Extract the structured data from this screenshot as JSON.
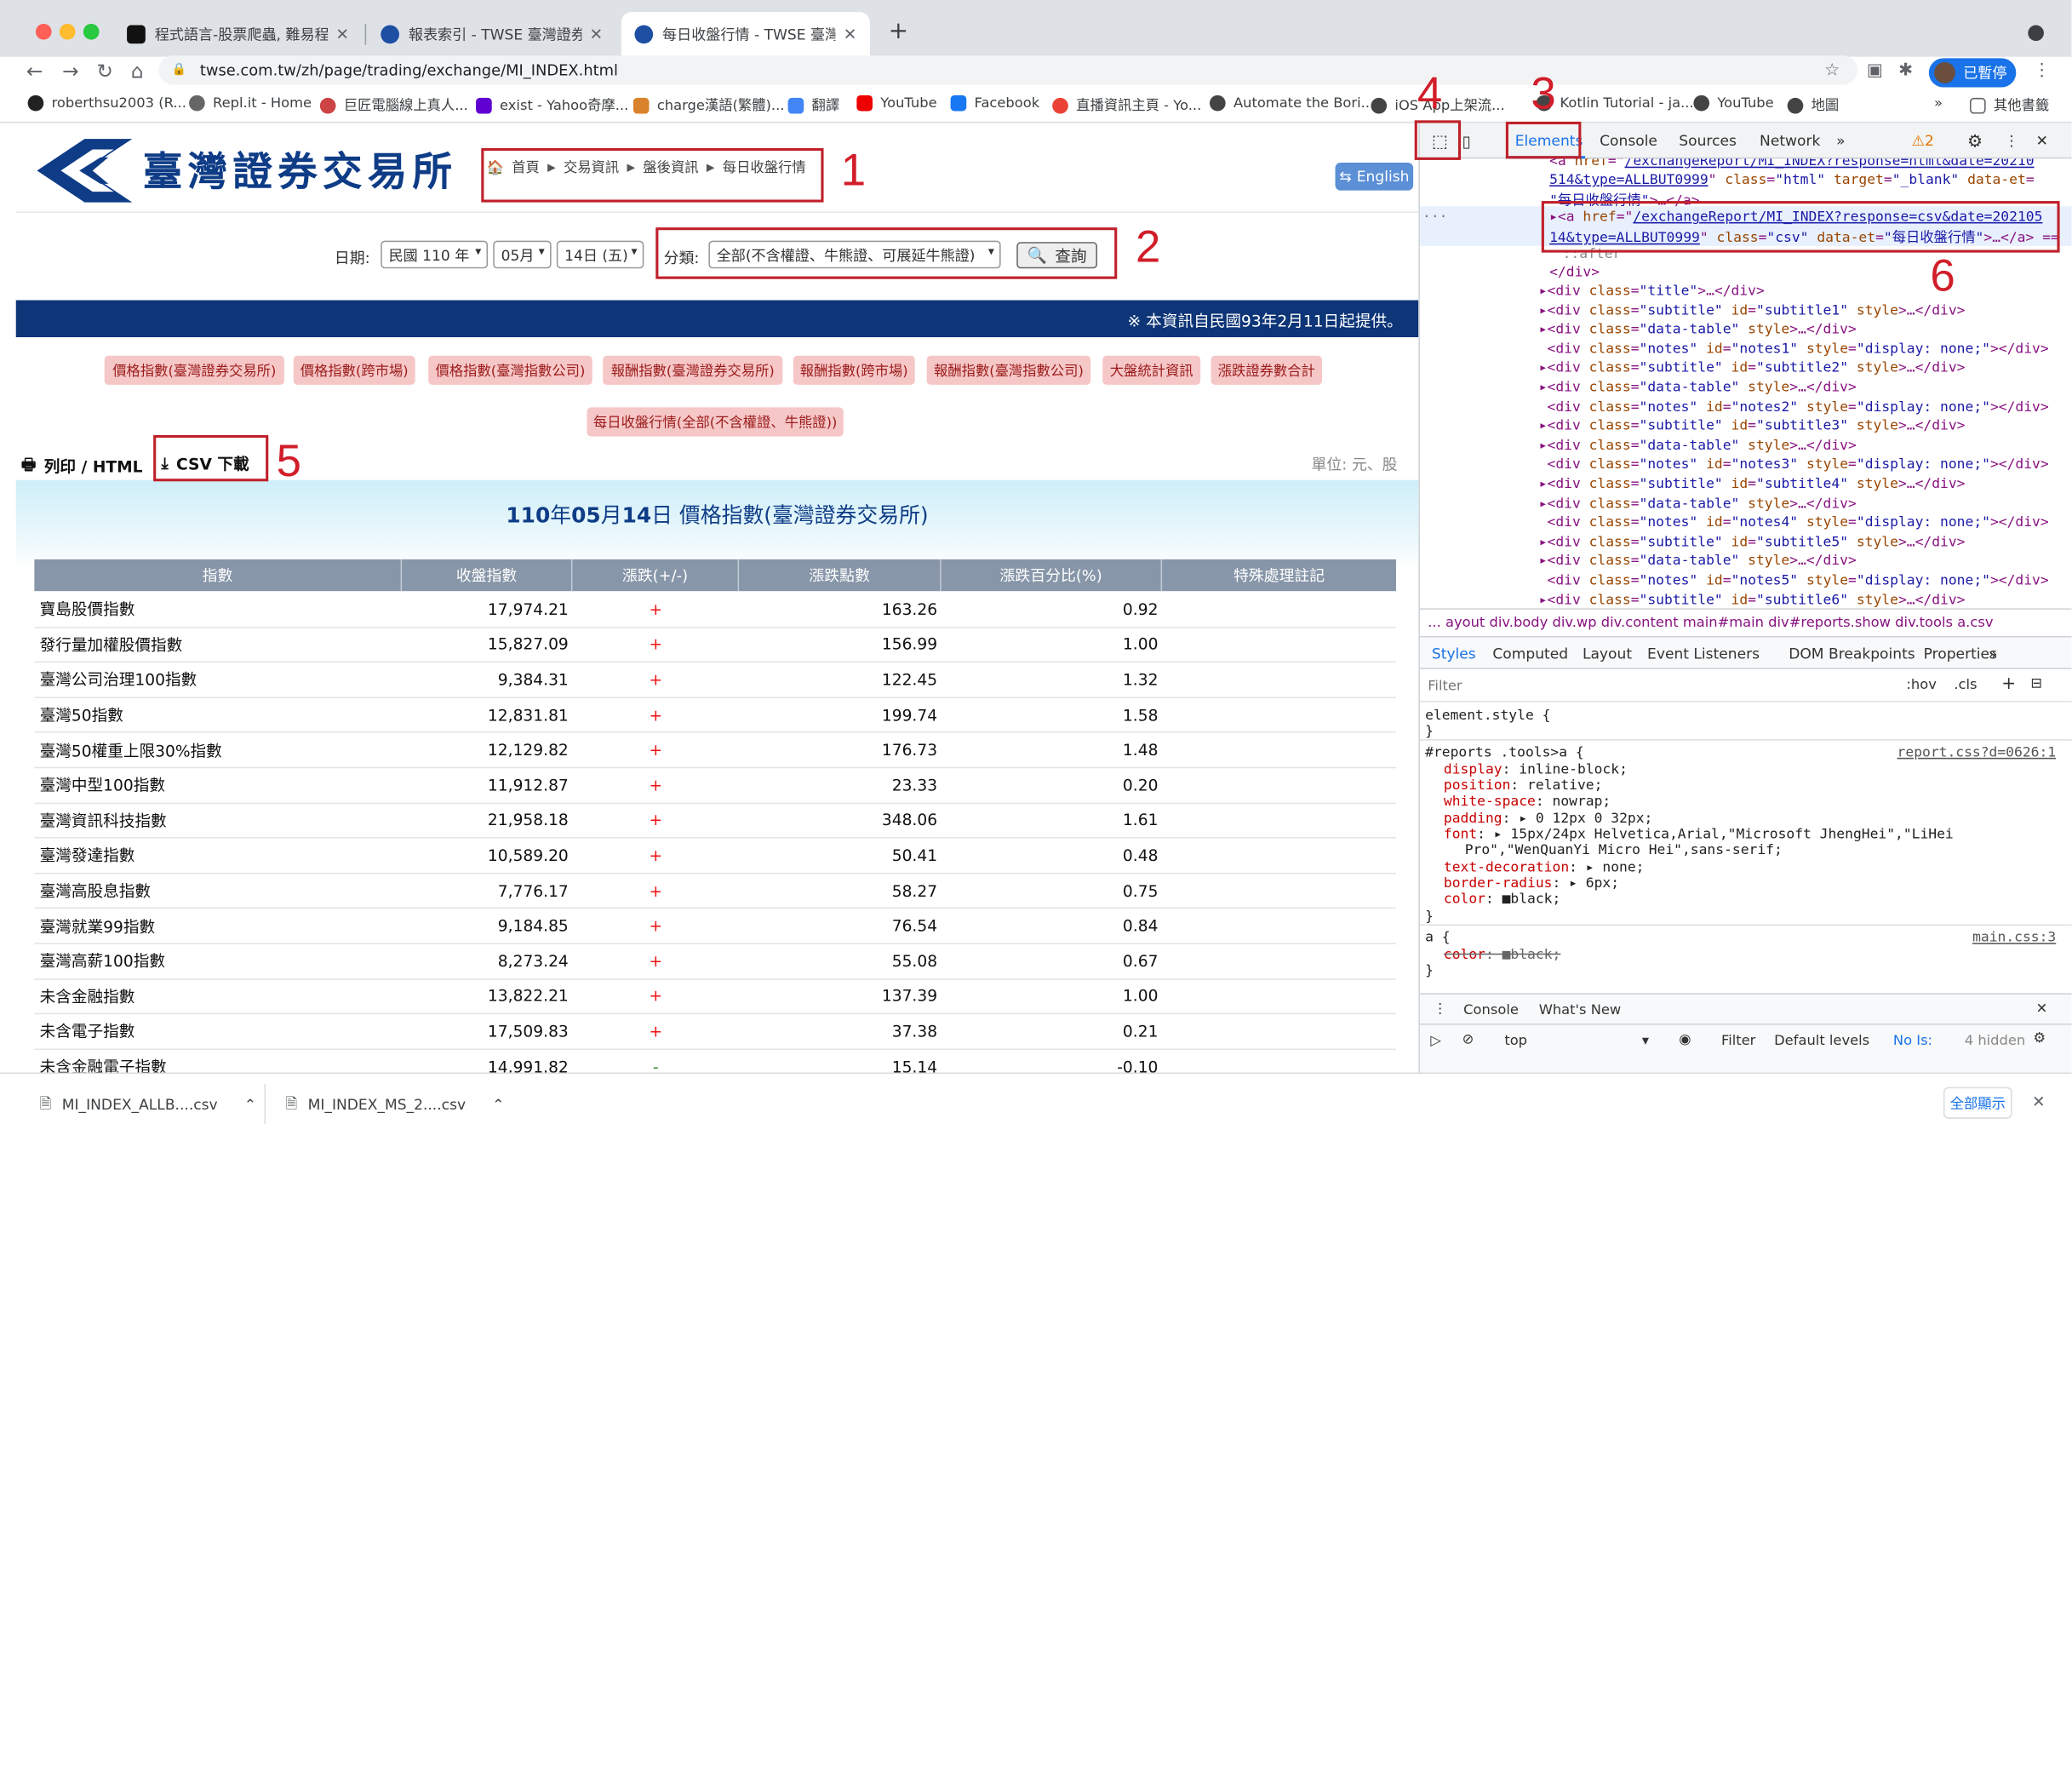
{
  "browser": {
    "tabs": [
      {
        "title": "程式語言-股票爬蟲, 難易程度★☆"
      },
      {
        "title": "報表索引 - TWSE 臺灣證券交易所"
      },
      {
        "title": "每日收盤行情 - TWSE 臺灣證券交易所"
      }
    ],
    "url": "twse.com.tw/zh/page/trading/exchange/MI_INDEX.html",
    "profile_label": "已暫停",
    "bookmarks": [
      "roberthsu2003 (R...",
      "Repl.it - Home",
      "巨匠電腦線上真人...",
      "exist - Yahoo奇摩...",
      "charge漢語(繁體)...",
      "翻譯",
      "YouTube",
      "Facebook",
      "直播資訊主頁 - Yo...",
      "Automate the Bori...",
      "iOS App上架流...",
      "Kotlin Tutorial - ja...",
      "YouTube",
      "地圖"
    ],
    "bookmark_more": "其他書籤"
  },
  "page": {
    "logo_text": "臺灣證券交易所",
    "breadcrumb": [
      "首頁",
      "交易資訊",
      "盤後資訊",
      "每日收盤行情"
    ],
    "english_btn": "English",
    "query": {
      "date_label": "日期:",
      "year": "民國 110 年",
      "month": "05月",
      "day": "14日 (五)",
      "category_label": "分類:",
      "category": "全部(不含權證、牛熊證、可展延牛熊證)",
      "search_btn": "查詢"
    },
    "banner": "※ 本資訊自民國93年2月11日起提供。",
    "pills": [
      "價格指數(臺灣證券交易所)",
      "價格指數(跨市場)",
      "價格指數(臺灣指數公司)",
      "報酬指數(臺灣證券交易所)",
      "報酬指數(跨市場)",
      "報酬指數(臺灣指數公司)",
      "大盤統計資訊",
      "漲跌證券數合計",
      "每日收盤行情(全部(不含權證、牛熊證))"
    ],
    "print_label": "列印 / HTML",
    "csv_label": "CSV 下載",
    "unit": "單位: 元、股",
    "caption_a": "110",
    "caption_b": "年",
    "caption_c": "05",
    "caption_d": "月",
    "caption_e": "14",
    "caption_f": "日 價格指數(臺灣證券交易所)",
    "table": {
      "headers": [
        "指數",
        "收盤指數",
        "漲跌(+/-)",
        "漲跌點數",
        "漲跌百分比(%)",
        "特殊處理註記"
      ],
      "rows": [
        [
          "寶島股價指數",
          "17,974.21",
          "+",
          "163.26",
          "0.92",
          ""
        ],
        [
          "發行量加權股價指數",
          "15,827.09",
          "+",
          "156.99",
          "1.00",
          ""
        ],
        [
          "臺灣公司治理100指數",
          "9,384.31",
          "+",
          "122.45",
          "1.32",
          ""
        ],
        [
          "臺灣50指數",
          "12,831.81",
          "+",
          "199.74",
          "1.58",
          ""
        ],
        [
          "臺灣50權重上限30%指數",
          "12,129.82",
          "+",
          "176.73",
          "1.48",
          ""
        ],
        [
          "臺灣中型100指數",
          "11,912.87",
          "+",
          "23.33",
          "0.20",
          ""
        ],
        [
          "臺灣資訊科技指數",
          "21,958.18",
          "+",
          "348.06",
          "1.61",
          ""
        ],
        [
          "臺灣發達指數",
          "10,589.20",
          "+",
          "50.41",
          "0.48",
          ""
        ],
        [
          "臺灣高股息指數",
          "7,776.17",
          "+",
          "58.27",
          "0.75",
          ""
        ],
        [
          "臺灣就業99指數",
          "9,184.85",
          "+",
          "76.54",
          "0.84",
          ""
        ],
        [
          "臺灣高薪100指數",
          "8,273.24",
          "+",
          "55.08",
          "0.67",
          ""
        ],
        [
          "未含金融指數",
          "13,822.21",
          "+",
          "137.39",
          "1.00",
          ""
        ],
        [
          "未含電子指數",
          "17,509.83",
          "+",
          "37.38",
          "0.21",
          ""
        ],
        [
          "未含金融電子指數",
          "14,991.82",
          "-",
          "15.14",
          "-0.10",
          ""
        ]
      ]
    }
  },
  "annotations": {
    "n1": "1",
    "n2": "2",
    "n3": "3",
    "n4": "4",
    "n5": "5",
    "n6": "6"
  },
  "devtools": {
    "tabs": [
      "Elements",
      "Console",
      "Sources",
      "Network"
    ],
    "warn_count": "2",
    "subtabs": [
      "Styles",
      "Computed",
      "Layout",
      "Event Listeners",
      "DOM Breakpoints",
      "Properties"
    ],
    "breadcrumbs": "... ayout   div.body   div.wp   div.content   main#main   div#reports.show   div.tools   a.csv",
    "filter": "Filter",
    "hov": ":hov",
    "cls": ".cls",
    "drawer_tabs": [
      "Console",
      "What's New"
    ],
    "context": "top",
    "levels": "Default levels",
    "noissues": "No Is:",
    "hidden": "4 hidden",
    "drawer_filter": "Filter"
  },
  "downloads": [
    {
      "name": "MI_INDEX_ALLB....csv"
    },
    {
      "name": "MI_INDEX_MS_2....csv"
    }
  ],
  "downloads_show_all": "全部顯示"
}
